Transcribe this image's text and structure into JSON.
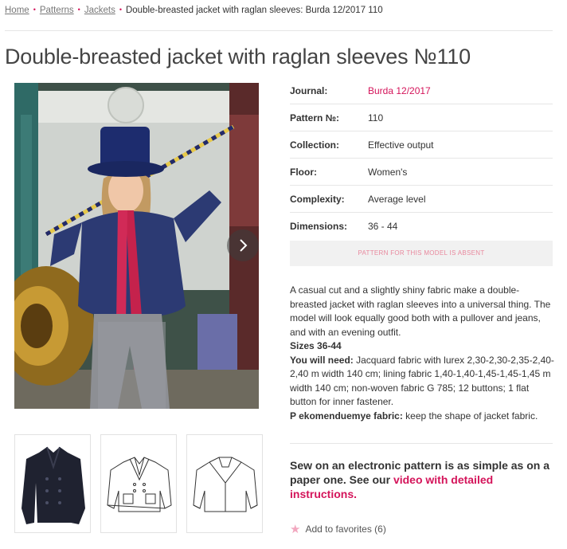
{
  "breadcrumb": {
    "items": [
      "Home",
      "Patterns",
      "Jackets"
    ],
    "current": "Double-breasted jacket with raglan sleeves: Burda 12/2017 110"
  },
  "title": "Double-breasted jacket with raglan sleeves №110",
  "specs": [
    {
      "label": "Journal:",
      "value": "Burda 12/2017"
    },
    {
      "label": "Pattern №:",
      "value": "110"
    },
    {
      "label": "Collection:",
      "value": "Effective output"
    },
    {
      "label": "Floor:",
      "value": "Women's"
    },
    {
      "label": "Complexity:",
      "value": "Average level"
    },
    {
      "label": "Dimensions:",
      "value": "36 - 44"
    }
  ],
  "absent_notice": "PATTERN FOR THIS MODEL IS ABSENT",
  "description": {
    "intro": "A casual cut and a slightly shiny fabric make a double-breasted jacket with raglan sleeves into a universal thing. The model will look equally good both with a pullover and jeans, and with an evening outfit.",
    "sizes": "Sizes 36-44",
    "need_label": "You will need:",
    "need_text": " Jacquard fabric with lurex 2,30-2,30-2,35-2,40-2,40 m width 140 cm; lining fabric 1,40-1,40-1,45-1,45-1,45 m width 140 cm; non-woven fabric G 785; 12 buttons; 1 flat button for inner fastener.",
    "fabric_label": "P ekomenduemye fabric:",
    "fabric_text": " keep the shape of jacket fabric."
  },
  "promo": {
    "text": "Sew on an electronic pattern is as simple as on a paper one. See our ",
    "link": "video with detailed instructions."
  },
  "favorites": {
    "label": "Add to favorites (6)"
  },
  "icons": {
    "star": "star-icon",
    "next": "chevron-right-icon"
  },
  "colors": {
    "accent": "#d4145a",
    "absent_text": "#e8889d"
  }
}
